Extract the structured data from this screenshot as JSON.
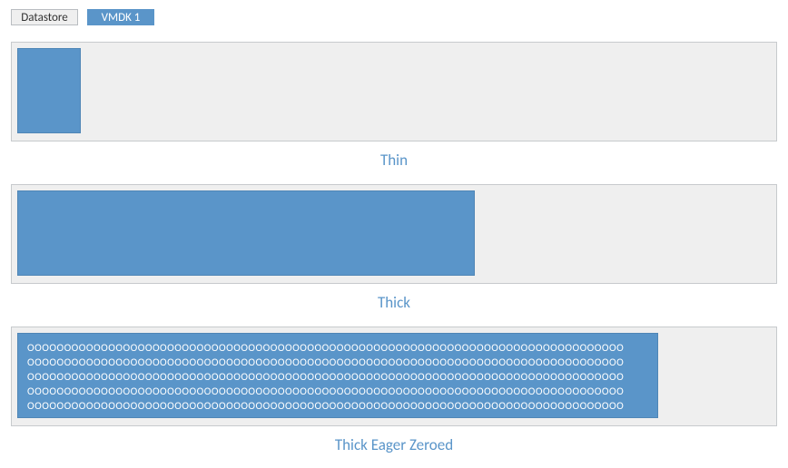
{
  "legend": {
    "datastore": "Datastore",
    "vmdk": "VMDK 1"
  },
  "colors": {
    "datastore_bg": "#efefef",
    "vmdk_bg": "#5a95c9",
    "caption": "#5a95c9",
    "border": "#c7cacd"
  },
  "sections": {
    "thin": {
      "caption": "Thin"
    },
    "thick": {
      "caption": "Thick"
    },
    "zero": {
      "caption": "Thick Eager Zeroed",
      "fill_lines": [
        "OOOOOOOOOOOOOOOOOOOOOOOOOOOOOOOOOOOOOOOOOOOOOOOOOOOOOOOOOOOOOOOOOOOOOOOOOOOOOOOOO",
        "OOOOOOOOOOOOOOOOOOOOOOOOOOOOOOOOOOOOOOOOOOOOOOOOOOOOOOOOOOOOOOOOOOOOOOOOOOOOOOOOO",
        "OOOOOOOOOOOOOOOOOOOOOOOOOOOOOOOOOOOOOOOOOOOOOOOOOOOOOOOOOOOOOOOOOOOOOOOOOOOOOOOOO",
        "OOOOOOOOOOOOOOOOOOOOOOOOOOOOOOOOOOOOOOOOOOOOOOOOOOOOOOOOOOOOOOOOOOOOOOOOOOOOOOOOO",
        "OOOOOOOOOOOOOOOOOOOOOOOOOOOOOOOOOOOOOOOOOOOOOOOOOOOOOOOOOOOOOOOOOOOOOOOOOOOOOOOOO"
      ]
    }
  }
}
